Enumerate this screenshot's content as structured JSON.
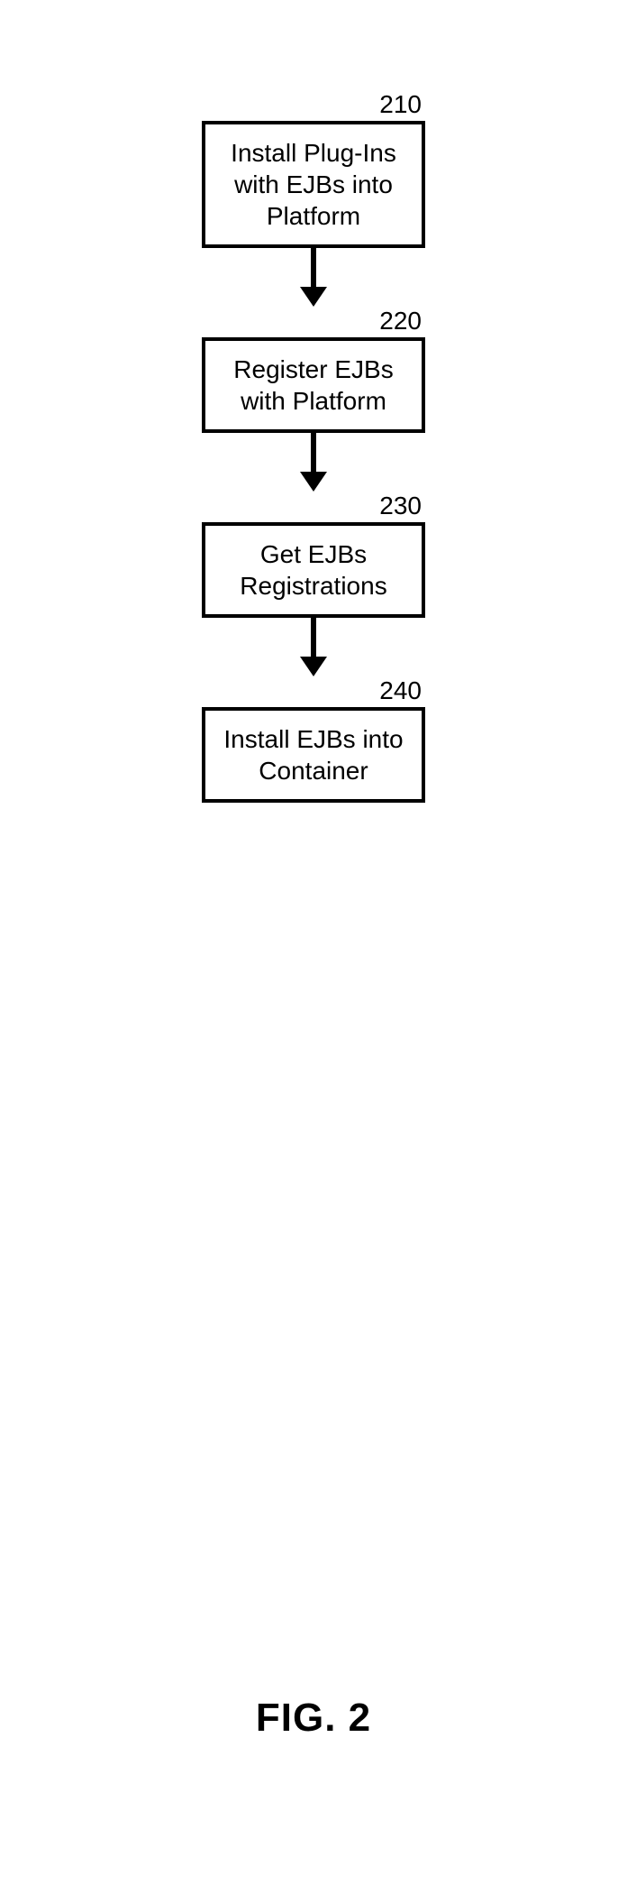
{
  "flowchart": {
    "nodes": [
      {
        "id": "210",
        "label": "210",
        "text": "Install Plug-Ins with EJBs into Platform"
      },
      {
        "id": "220",
        "label": "220",
        "text": "Register EJBs with Platform"
      },
      {
        "id": "230",
        "label": "230",
        "text": "Get EJBs Registrations"
      },
      {
        "id": "240",
        "label": "240",
        "text": "Install EJBs into Container"
      }
    ],
    "caption": "FIG. 2"
  }
}
